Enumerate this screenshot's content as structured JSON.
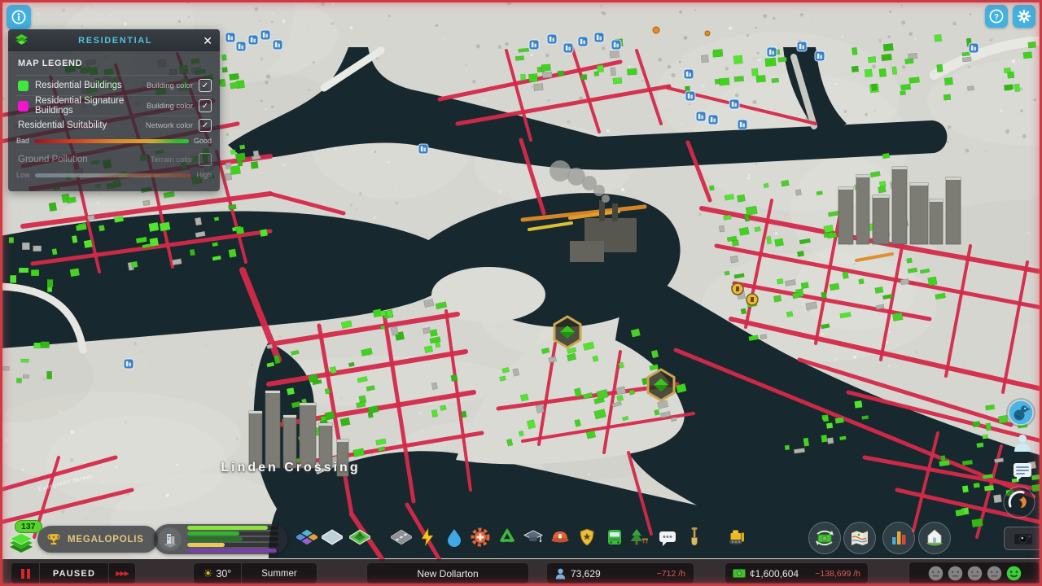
{
  "icons": {
    "info": "info-circle",
    "help": "?",
    "settings": "gear",
    "close": "✕",
    "check": "✓",
    "sun": "☀",
    "pause": "❚❚",
    "fast_forward": "▶▶▶"
  },
  "legend": {
    "title": "RESIDENTIAL",
    "close": "✕",
    "section": "MAP LEGEND",
    "rows": {
      "r1": {
        "label": "Residential Buildings",
        "kind": "Building color",
        "checked": true
      },
      "r2": {
        "label": "Residential Signature Buildings",
        "kind": "Building color",
        "checked": true
      },
      "r3": {
        "label": "Residential Suitability",
        "kind": "Network color",
        "checked": true,
        "left": "Bad",
        "right": "Good"
      },
      "r4": {
        "label": "Ground Pollution",
        "kind": "Terrain color",
        "checked": false,
        "left": "Low",
        "right": "High"
      }
    },
    "colors": {
      "residential": "#3fe83f",
      "signature": "#f214cf"
    }
  },
  "map": {
    "district_label": "Linden Crossing",
    "street_label": "Evergreen Street"
  },
  "toolbar": {
    "xp_level": "137",
    "milestone": "MEGALOPOLIS",
    "demand_bars": [
      {
        "name": "residential-low-demand",
        "color": "#8ae23c",
        "pct": 88
      },
      {
        "name": "residential-medium-demand",
        "color": "#2fb32a",
        "pct": 57
      },
      {
        "name": "residential-high-demand",
        "color": "#1d7a22",
        "pct": 61
      },
      {
        "name": "commercial-demand",
        "color": "#e8c95a",
        "pct": 41
      },
      {
        "name": "office-demand",
        "color": "#7a3fa8",
        "pct": 98
      }
    ],
    "tools": [
      "zones",
      "districts",
      "landscaping",
      "roads",
      "electricity",
      "water",
      "healthcare",
      "garbage",
      "education",
      "fire",
      "police",
      "transportation",
      "parks",
      "communications",
      "terraforming",
      "bulldozer"
    ],
    "actions": [
      "economy",
      "map-tiles",
      "statistics",
      "city-info",
      "photo-mode"
    ]
  },
  "statusbar": {
    "sim_state": "PAUSED",
    "temperature": "30°",
    "season": "Summer",
    "city_name": "New Dollarton",
    "population": "73,629",
    "population_rate": "−712 /h",
    "money": "¢1,600,604",
    "money_rate": "−138,699 /h",
    "happiness_levels": 5,
    "happiness_active_color": "#3ad23a"
  }
}
